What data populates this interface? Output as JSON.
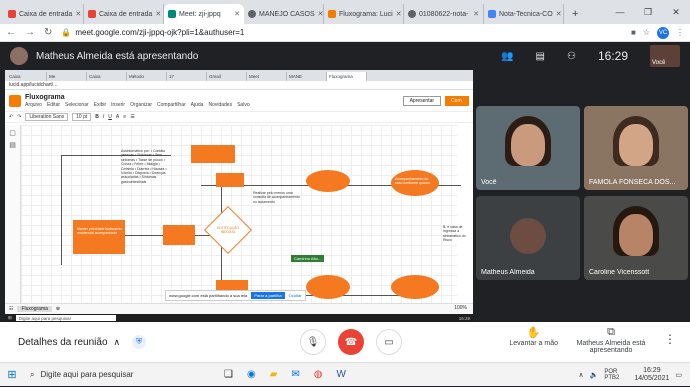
{
  "browser": {
    "tabs": [
      {
        "label": "Caixa de entrada",
        "color": "#ea4335"
      },
      {
        "label": "Caixa de entrada",
        "color": "#ea4335"
      },
      {
        "label": "Meet: zji-jppq",
        "color": "#00897b",
        "active": true
      },
      {
        "label": "MANEJO CASOS",
        "color": "#5f6368"
      },
      {
        "label": "Fluxograma: Luci",
        "color": "#f57c00"
      },
      {
        "label": "01080622-nota-",
        "color": "#5f6368"
      },
      {
        "label": "Nota-Tecnica-CO",
        "color": "#4285f4"
      }
    ],
    "url": "meet.google.com/zji-jppq-ojk?pli=1&authuser=1",
    "window_controls": [
      "—",
      "❐",
      "✕"
    ]
  },
  "meet": {
    "presenter_text": "Matheus Almeida está apresentando",
    "clock": "16:29",
    "self_label": "Você",
    "participants": [
      {
        "name": "Você"
      },
      {
        "name": "FAMOLA FONSECA DOS..."
      },
      {
        "name": "Matheus Almeida"
      },
      {
        "name": "Caroline Vicenssott"
      }
    ],
    "controls": {
      "details_label": "Detalhes da reunião",
      "raise_hand_label": "Levantar a mão",
      "presenting_label": "Matheus Almeida está apresentando"
    }
  },
  "shared_screen": {
    "inner_url": "lucid.app/lucidchart/...",
    "app_title": "Fluxograma",
    "menu": [
      "Arquivo",
      "Editar",
      "Selecionar",
      "Exibir",
      "Inserir",
      "Organizar",
      "Compartilhar",
      "Ajuda",
      "Novidades",
      "Salvo"
    ],
    "present_label": "Apresentar",
    "share_label": "Com.",
    "font_name": "Liberation Sans",
    "font_size": "10 pt",
    "diagram": {
      "decision_label": "NOTIFICAÇÃO IMEDIATA",
      "green_tag": "Caminho Alto...",
      "symptoms_list": "Assintomático por: • Contato pessoas • Sintomas • Sem sintomas • Tosse de pouco • Coriza • Febre • Mialgia • Cefaleia • Diarreia • Náusea • Vômito • Dispneia • Doenças associadas • Sintomas gastrointestinais",
      "note_left": "Manter prioridade isolamento residencial acompanhado",
      "note_mid": "Realizar pelo menos uma consulta de acompanhamento no isolamento",
      "note_right": "Acompanhamento do caso conforme quadro",
      "right_text": "B, e casa de ingressa a sintomático do Risco"
    },
    "sheet_tab": "Fluxograma",
    "share_notice": "www.google.com está partilhando a sua tela",
    "stop_share": "Parar a partilha",
    "hide_notice": "Ocultar",
    "zoom": "100%",
    "inner_search": "Digite aqui para pesquisar",
    "inner_time": "16:29"
  },
  "taskbar": {
    "search_placeholder": "Digite aqui para pesquisar",
    "lang": "POR PTB2",
    "time": "16:29",
    "date": "14/05/2021"
  }
}
